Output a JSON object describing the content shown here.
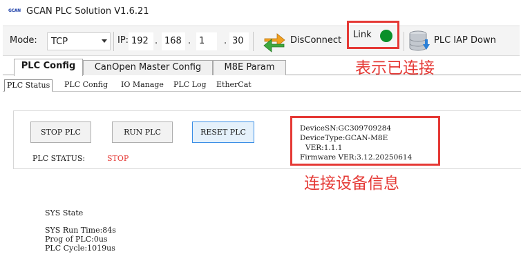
{
  "window": {
    "logo_text": "GCAN",
    "title": "GCAN PLC Solution V1.6.21"
  },
  "toolbar": {
    "mode_label": "Mode:",
    "mode_value": "TCP",
    "ip_label": "IP:",
    "ip": [
      "192",
      "168",
      "1",
      "30"
    ],
    "ip_separator": ".",
    "disconnect_label": "DisConnect",
    "link_label": "Link",
    "link_status_color": "#0a8f2a",
    "iap_label": "PLC IAP Down",
    "icons": [
      "refresh-arrows-icon",
      "database-download-icon"
    ]
  },
  "annotations": {
    "link_note": "表示已连接",
    "device_note": "连接设备信息",
    "color": "#e53935"
  },
  "tabs": [
    {
      "label": "PLC Config",
      "active": true
    },
    {
      "label": "CanOpen Master Config",
      "active": false
    },
    {
      "label": "M8E Param",
      "active": false
    }
  ],
  "subtabs": [
    {
      "label": "PLC Status",
      "active": true
    },
    {
      "label": "PLC Config",
      "active": false
    },
    {
      "label": "IO Manage",
      "active": false
    },
    {
      "label": "PLC Log",
      "active": false
    },
    {
      "label": "EtherCat",
      "active": false
    }
  ],
  "controls": {
    "stop_label": "STOP PLC",
    "run_label": "RUN PLC",
    "reset_label": "RESET PLC",
    "status_label": "PLC STATUS:",
    "status_value": "STOP",
    "status_color": "#e53935"
  },
  "device_info": {
    "sn": "DeviceSN:GC309709284",
    "type": "DeviceType:GCAN-M8E",
    "ver": "VER:1.1.1",
    "firmware": "Firmware VER:3.12.20250614"
  },
  "sys_state": {
    "title": "SYS State",
    "run_time": "SYS Run Time:84s",
    "prog": "Prog of PLC:0us",
    "cycle": "PLC Cycle:1019us"
  }
}
